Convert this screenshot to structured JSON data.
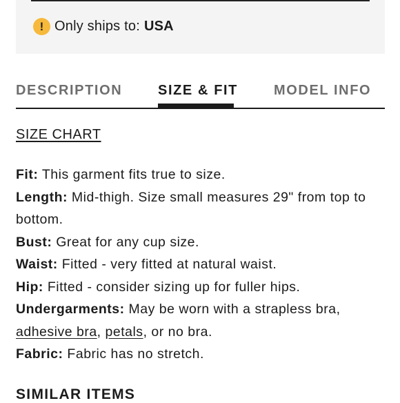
{
  "shipping": {
    "icon": "alert-circle-icon",
    "icon_glyph": "!",
    "label": "Only ships to:",
    "country": "USA",
    "icon_color": "#f6b93b"
  },
  "tabs": [
    {
      "label": "DESCRIPTION",
      "active": false
    },
    {
      "label": "SIZE & FIT",
      "active": true
    },
    {
      "label": "MODEL INFO",
      "active": false
    }
  ],
  "size_chart_link": "SIZE CHART",
  "details": {
    "fit": {
      "label": "Fit:",
      "text": " This garment fits true to size."
    },
    "length": {
      "label": "Length:",
      "text": " Mid-thigh. Size small measures 29\" from top to bottom."
    },
    "bust": {
      "label": "Bust:",
      "text": " Great for any cup size."
    },
    "waist": {
      "label": "Waist:",
      "text": " Fitted - very fitted at natural waist."
    },
    "hip": {
      "label": "Hip:",
      "text": " Fitted - consider sizing up for fuller hips."
    },
    "undergarments": {
      "label": "Undergarments:",
      "text_before": " May be worn with a strapless bra, ",
      "link1": "adhesive bra",
      "sep": ", ",
      "link2": "petals",
      "text_after": ", or no bra."
    },
    "fabric": {
      "label": "Fabric:",
      "text": " Fabric has no stretch."
    }
  },
  "similar_items_heading": "SIMILAR ITEMS"
}
